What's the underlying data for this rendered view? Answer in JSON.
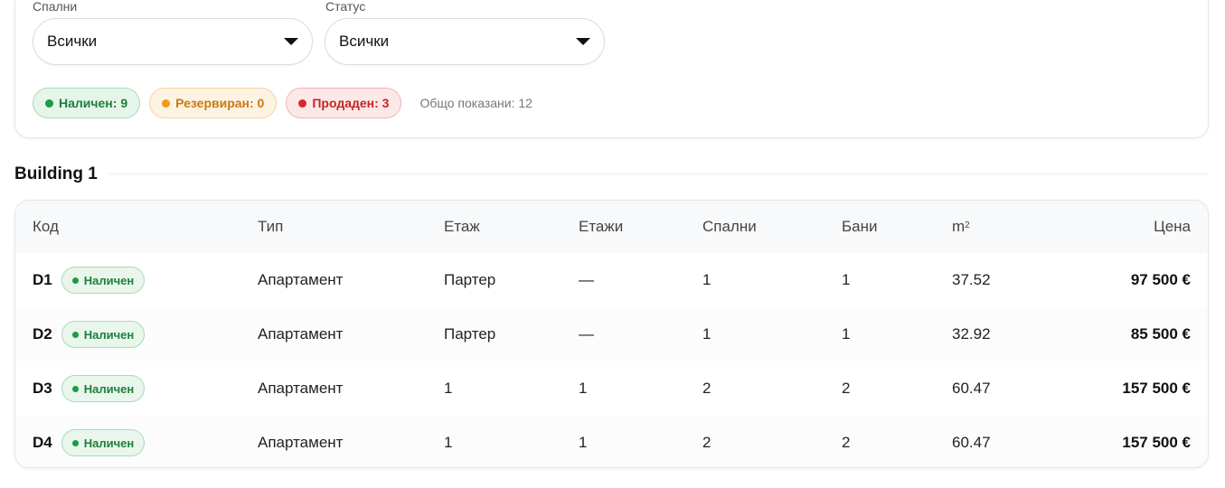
{
  "filters": {
    "bedrooms": {
      "label": "Спални",
      "value": "Всички"
    },
    "status": {
      "label": "Статус",
      "value": "Всички"
    }
  },
  "summary": {
    "available": "Наличен: 9",
    "reserved": "Резервиран: 0",
    "sold": "Продаден: 3",
    "total": "Общо показани: 12"
  },
  "section": {
    "title": "Building 1"
  },
  "table": {
    "headers": {
      "code": "Код",
      "type": "Тип",
      "floor": "Етаж",
      "floors": "Етажи",
      "bedrooms": "Спални",
      "bathrooms": "Бани",
      "area": "m",
      "area_sup": "2",
      "price": "Цена"
    },
    "rows": [
      {
        "code": "D1",
        "status": "Наличен",
        "type": "Апартамент",
        "floor": "Партер",
        "floors": "—",
        "bedrooms": "1",
        "bathrooms": "1",
        "area": "37.52",
        "price": "97 500 €"
      },
      {
        "code": "D2",
        "status": "Наличен",
        "type": "Апартамент",
        "floor": "Партер",
        "floors": "—",
        "bedrooms": "1",
        "bathrooms": "1",
        "area": "32.92",
        "price": "85 500 €"
      },
      {
        "code": "D3",
        "status": "Наличен",
        "type": "Апартамент",
        "floor": "1",
        "floors": "1",
        "bedrooms": "2",
        "bathrooms": "2",
        "area": "60.47",
        "price": "157 500 €"
      },
      {
        "code": "D4",
        "status": "Наличен",
        "type": "Апартамент",
        "floor": "1",
        "floors": "1",
        "bedrooms": "2",
        "bathrooms": "2",
        "area": "60.47",
        "price": "157 500 €"
      }
    ]
  },
  "colors": {
    "available": "#1e9a45",
    "reserved": "#f29b11",
    "sold": "#d42a2a"
  }
}
